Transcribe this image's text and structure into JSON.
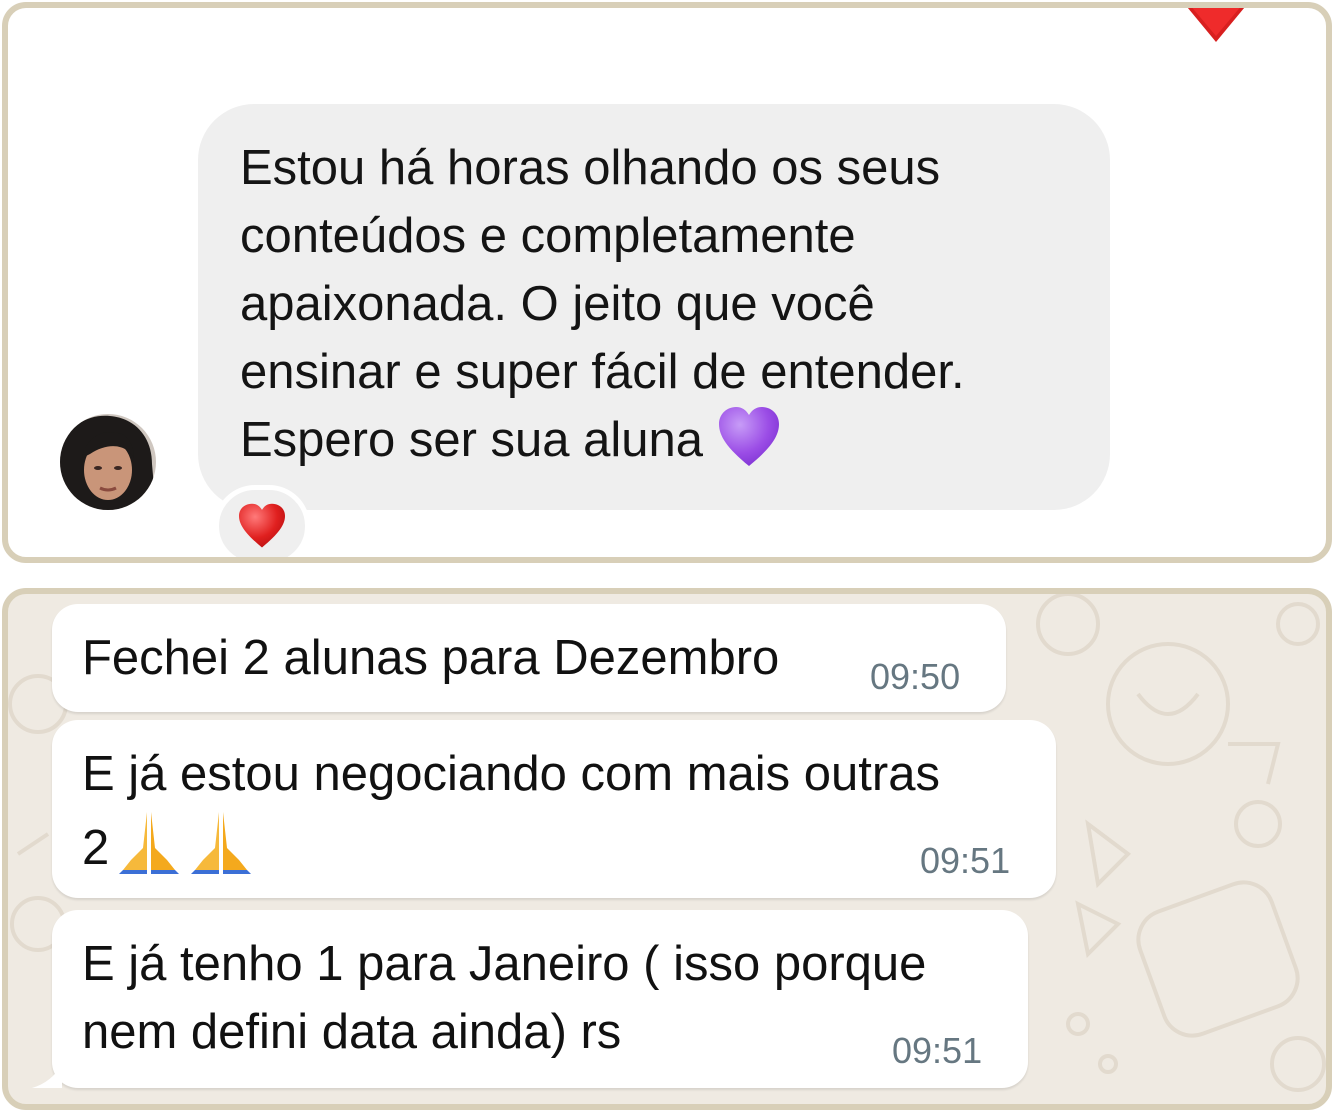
{
  "instagram_dm": {
    "message_lines": [
      "Estou há horas olhando os seus",
      "conteúdos e completamente",
      "apaixonada.  O jeito que você",
      "ensinar e super fácil de entender.",
      "Espero ser sua aluna"
    ],
    "emoji_end": "purple-heart-icon",
    "reaction_emoji": "red-heart-icon"
  },
  "whatsapp": {
    "messages": [
      {
        "lines": [
          "Fechei 2 alunas para Dezembro"
        ],
        "time": "09:50"
      },
      {
        "lines": [
          "E já estou negociando com mais outras",
          "2"
        ],
        "emoji": "folded-hands-icon",
        "time": "09:51"
      },
      {
        "lines": [
          "E já tenho 1 para Janeiro ( isso porque",
          "nem defini data ainda) rs"
        ],
        "time": "09:51"
      }
    ]
  },
  "colors": {
    "frame_border": "#d8cfb8",
    "ig_bubble": "#efefef",
    "wa_background": "#efeae2",
    "wa_bubble": "#ffffff",
    "wa_time": "#667781",
    "heart_red": "#e0201f",
    "heart_purple": "#9b4de6"
  }
}
